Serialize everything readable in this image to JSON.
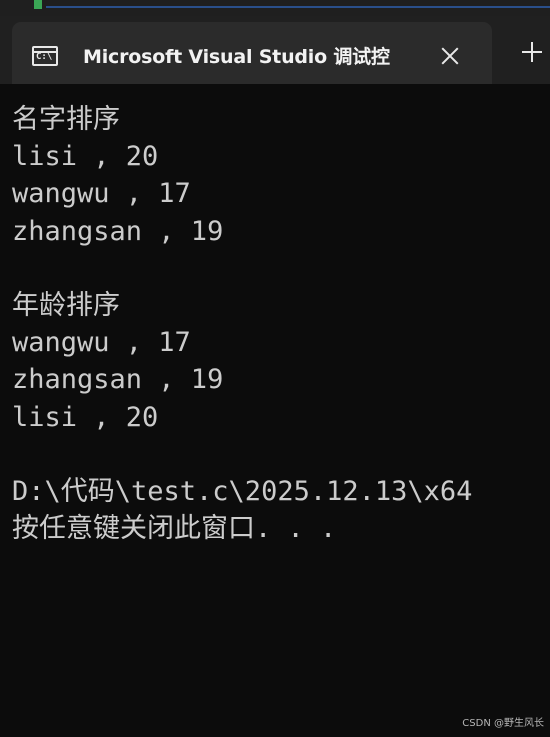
{
  "window": {
    "tab_title": "Microsoft Visual Studio 调试控",
    "tab_icon": "console-app-icon",
    "tab_icon_glyph": "C:\\",
    "close_icon": "close-icon",
    "new_tab_icon": "plus-icon"
  },
  "console": {
    "lines": [
      "名字排序",
      "lisi , 20",
      "wangwu , 17",
      "zhangsan , 19",
      "",
      "年龄排序",
      "wangwu , 17",
      "zhangsan , 19",
      "lisi , 20",
      "",
      "D:\\代码\\test.c\\2025.12.13\\x64",
      "按任意键关闭此窗口. . ."
    ],
    "text_color": "#cccccc",
    "background": "#0c0c0c"
  },
  "watermark": {
    "text": "CSDN @野生风长"
  }
}
